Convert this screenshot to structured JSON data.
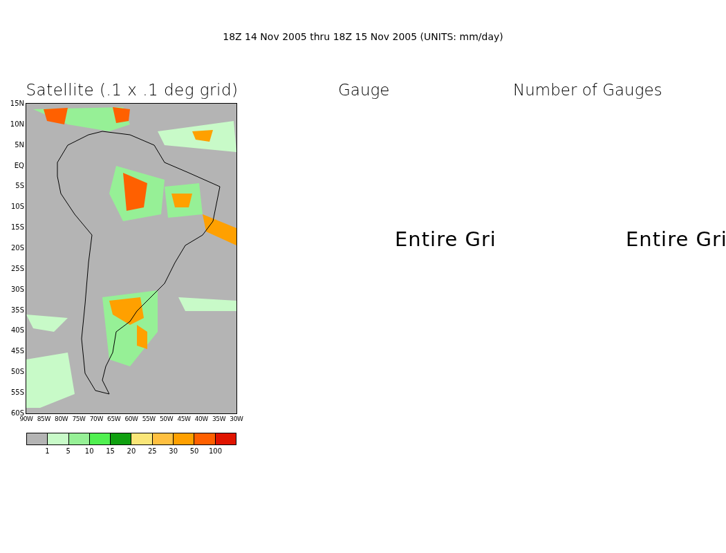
{
  "title": "18Z 14 Nov 2005 thru 18Z 15 Nov 2005 (UNITS: mm/day)",
  "panels": [
    {
      "kind": "map",
      "title": "Satellite (.1 x .1 deg grid)",
      "y_labels": [
        "15N",
        "10N",
        "5N",
        "EQ",
        "5S",
        "10S",
        "15S",
        "20S",
        "25S",
        "30S",
        "35S",
        "40S",
        "45S",
        "50S",
        "55S",
        "60S"
      ],
      "x_labels": [
        "90W",
        "85W",
        "80W",
        "75W",
        "70W",
        "65W",
        "60W",
        "55W",
        "50W",
        "45W",
        "40W",
        "35W",
        "30W"
      ]
    },
    {
      "kind": "empty",
      "title": "Gauge",
      "message": "Entire Gri"
    },
    {
      "kind": "empty",
      "title": "Number of Gauges",
      "message": "Entire Gri"
    }
  ],
  "legend": {
    "swatches": [
      {
        "color": "#b4b4b4"
      },
      {
        "color": "#c8fac8"
      },
      {
        "color": "#96f096"
      },
      {
        "color": "#50f050"
      },
      {
        "color": "#10a010"
      },
      {
        "color": "#fae678"
      },
      {
        "color": "#ffc040"
      },
      {
        "color": "#ffa000"
      },
      {
        "color": "#ff6000"
      },
      {
        "color": "#e01400"
      }
    ],
    "labels": [
      "1",
      "5",
      "10",
      "15",
      "20",
      "25",
      "30",
      "50",
      "100"
    ]
  }
}
